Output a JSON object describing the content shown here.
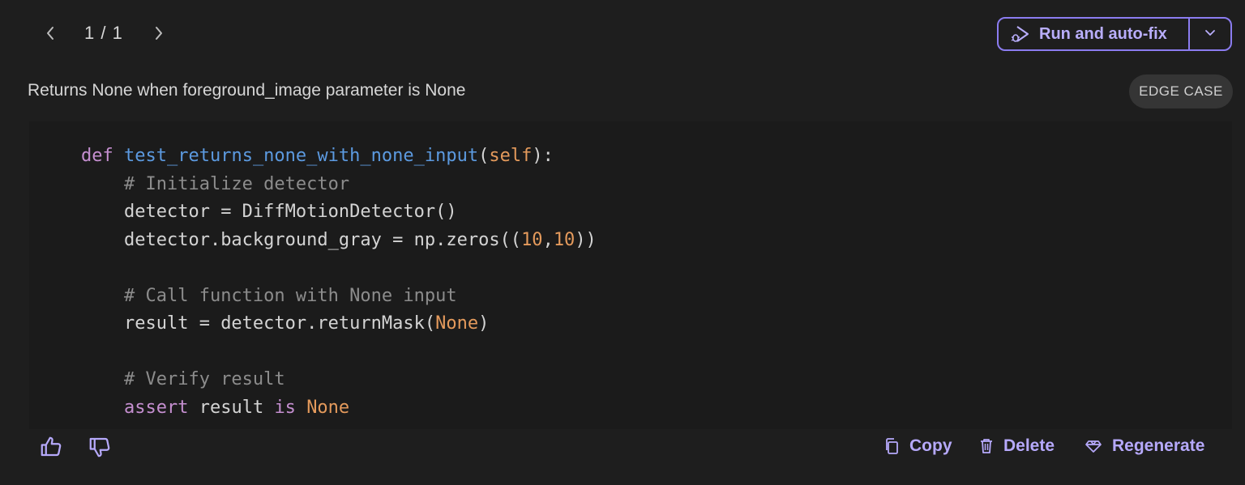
{
  "pager": {
    "count": "1 / 1",
    "prev_icon": "chevron-left-icon",
    "next_icon": "chevron-right-icon"
  },
  "run_button": {
    "label": "Run and auto-fix",
    "icon": "run-debug-icon",
    "dropdown_icon": "chevron-down-icon"
  },
  "test": {
    "description": "Returns None when foreground_image parameter is None",
    "badge": "EDGE CASE"
  },
  "code": {
    "l1_kw": "def",
    "l1_fn": "test_returns_none_with_none_input",
    "l1_open": "(",
    "l1_self": "self",
    "l1_close": "):",
    "l2": "# Initialize detector",
    "l3": "detector = DiffMotionDetector()",
    "l4_a": "detector.background_gray = np.zeros((",
    "l4_n1": "10",
    "l4_comma": ",",
    "l4_n2": "10",
    "l4_b": "))",
    "l6": "# Call function with None input",
    "l7_a": "result = detector.returnMask(",
    "l7_none": "None",
    "l7_b": ")",
    "l9": "# Verify result",
    "l10_kw": "assert",
    "l10_mid": " result ",
    "l10_is": "is",
    "l10_none": "None"
  },
  "footer": {
    "copy_label": "Copy",
    "delete_label": "Delete",
    "regenerate_label": "Regenerate"
  },
  "colors": {
    "accent": "#8b7cf0",
    "accent_text": "#b9aefc",
    "background": "#1e1e1e",
    "keyword": "#c58fd0",
    "function": "#5c9ae0",
    "number": "#e49a5c",
    "comment": "#8c8c8c"
  }
}
